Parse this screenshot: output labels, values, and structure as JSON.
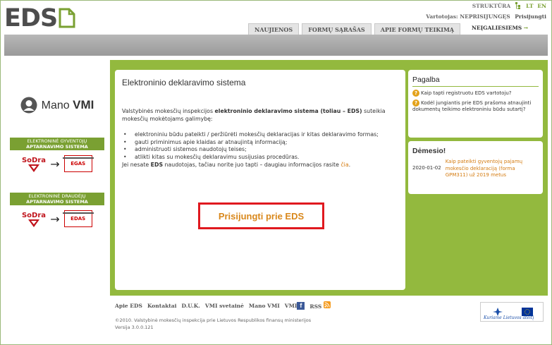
{
  "header": {
    "logo_text": "EDS",
    "struktura": "STRUKTŪRA",
    "lang_lt": "LT",
    "lang_en": "EN",
    "user_label": "Vartotojas: NEPRISIJUNGĘS",
    "login_link": "Prisijungti",
    "tabs": [
      {
        "label": "NAUJIENOS"
      },
      {
        "label": "FORMŲ SĄRAŠAS"
      },
      {
        "label": "APIE FORMŲ TEIKIMĄ"
      }
    ],
    "disabled_link": "NEĮGALIESIEMS",
    "disabled_arrow": "→"
  },
  "left": {
    "mano_prefix": "Mano",
    "mano_brand": "VMI",
    "systems": [
      {
        "line1": "ELEKTRONINĖ GYVENTOJŲ",
        "line2": "APTARNAVIMO SISTEMA",
        "badge": "EGAS"
      },
      {
        "line1": "ELEKTRONINĖ DRAUDĖJŲ",
        "line2": "APTARNAVIMO SISTEMA",
        "badge": "EDAS"
      }
    ],
    "sodra_label": "SoDra",
    "arrow": "→"
  },
  "main": {
    "title": "Elektroninio deklaravimo sistema",
    "intro_pre": "Valstybinės mokesčių inspekcijos ",
    "intro_bold": "elektroninio deklaravimo sistema (toliau – EDS)",
    "intro_post": " suteikia mokesčių mokėtojams galimybę:",
    "bullets": [
      "elektroniniu būdu pateikti / peržiūrėti mokesčių deklaracijas ir kitas deklaravimo formas;",
      "gauti priminimus apie klaidas ar atnaujintą informaciją;",
      "administruoti sistemos naudotojų teises;",
      "atlikti kitas su mokesčių deklaravimu susijusias procedūras."
    ],
    "more_pre": "Jei nesate ",
    "more_bold": "EDS",
    "more_mid": " naudotojas, tačiau norite juo tapti – daugiau informacijos rasite ",
    "more_link": "čia",
    "more_post": ".",
    "login_button": "Prisijungti prie EDS"
  },
  "help": {
    "title": "Pagalba",
    "items": [
      "Kaip tapti registruotu EDS vartotoju?",
      "Kodėl jungiantis prie EDS prašoma atnaujinti dokumentų teikimo elektroniniu būdu sutartį?"
    ]
  },
  "attention": {
    "title": "Dėmesio!",
    "date": "2020-01-02",
    "link": "Kaip pateikti gyventojų pajamų mokesčio deklaraciją (forma GPM311) už 2019 metus"
  },
  "footer": {
    "links": [
      "Apie EDS",
      "Kontaktai",
      "D.U.K.",
      "VMI svetainė",
      "Mano VMI",
      "VMI",
      "RSS"
    ],
    "copyright": "©2010. Valstybinė mokesčių inspekcija prie Lietuvos Respublikos finansų ministerijos",
    "version": "Versija 3.0.0.121",
    "eu_slogan": "Kuriame Lietuvos ateitį"
  },
  "colors": {
    "accent_green": "#93b93e",
    "link_orange": "#d47b10",
    "highlight_red": "#e0191f"
  }
}
